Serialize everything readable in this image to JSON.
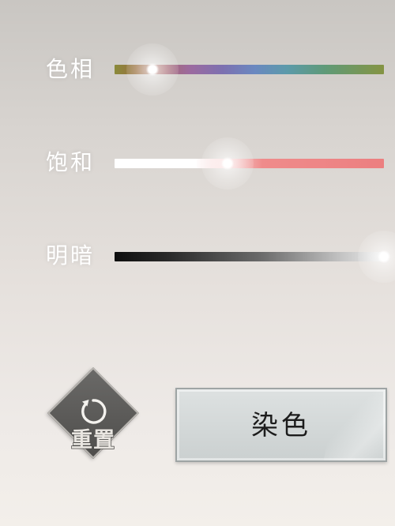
{
  "sliders": [
    {
      "label": "色相",
      "value": 0.14
    },
    {
      "label": "饱和",
      "value": 0.42
    },
    {
      "label": "明暗",
      "value": 1.0
    }
  ],
  "reset": {
    "label": "重置",
    "icon": "rotate-ccw-icon"
  },
  "dye_button": {
    "label": "染色"
  },
  "colors": {
    "label_text": "#ffffff",
    "dye_label": "#1c1c1c",
    "reset_diamond": "#5a5957",
    "saturation_end": "#ec7f80"
  }
}
